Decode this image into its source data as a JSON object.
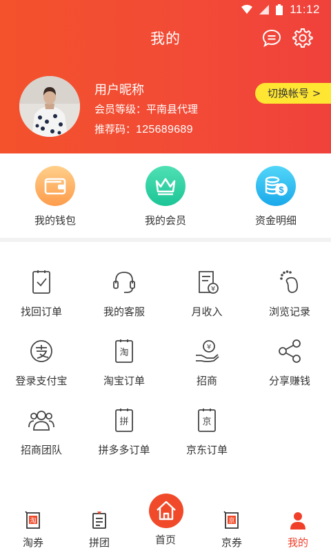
{
  "status": {
    "time": "11:12"
  },
  "header": {
    "title": "我的"
  },
  "profile": {
    "nickname": "用户昵称",
    "level_label": "会员等级：",
    "level_value": "平南县代理",
    "ref_label": "推荐码：",
    "ref_code": "125689689",
    "switch_label": "切换帐号 >"
  },
  "quick": [
    {
      "label": "我的钱包",
      "icon": "wallet-icon"
    },
    {
      "label": "我的会员",
      "icon": "crown-icon"
    },
    {
      "label": "资金明细",
      "icon": "coins-icon"
    }
  ],
  "grid": [
    {
      "label": "找回订单",
      "icon": "order-check-icon"
    },
    {
      "label": "我的客服",
      "icon": "headset-icon"
    },
    {
      "label": "月收入",
      "icon": "income-icon"
    },
    {
      "label": "浏览记录",
      "icon": "footprint-icon"
    },
    {
      "label": "登录支付宝",
      "icon": "alipay-icon"
    },
    {
      "label": "淘宝订单",
      "icon": "taobao-order-icon"
    },
    {
      "label": "招商",
      "icon": "hand-coin-icon"
    },
    {
      "label": "分享赚钱",
      "icon": "share-icon"
    },
    {
      "label": "招商团队",
      "icon": "team-icon"
    },
    {
      "label": "拼多多订单",
      "icon": "pdd-order-icon"
    },
    {
      "label": "京东订单",
      "icon": "jd-order-icon"
    }
  ],
  "grid_icon_chars": {
    "taobao": "淘",
    "pdd": "拼",
    "jd": "京"
  },
  "nav": [
    {
      "label": "淘券",
      "icon": "taobao-coupon-icon",
      "badge": "淘"
    },
    {
      "label": "拼团",
      "icon": "group-buy-icon"
    },
    {
      "label": "首页",
      "icon": "home-icon"
    },
    {
      "label": "京券",
      "icon": "jd-coupon-icon",
      "badge": "京"
    },
    {
      "label": "我的",
      "icon": "user-icon",
      "active": true
    }
  ],
  "colors": {
    "accent": "#f04a2a",
    "header_start": "#f3522c",
    "header_end": "#f0413b",
    "switch_bg": "#ffe633",
    "active": "#f0402a"
  }
}
